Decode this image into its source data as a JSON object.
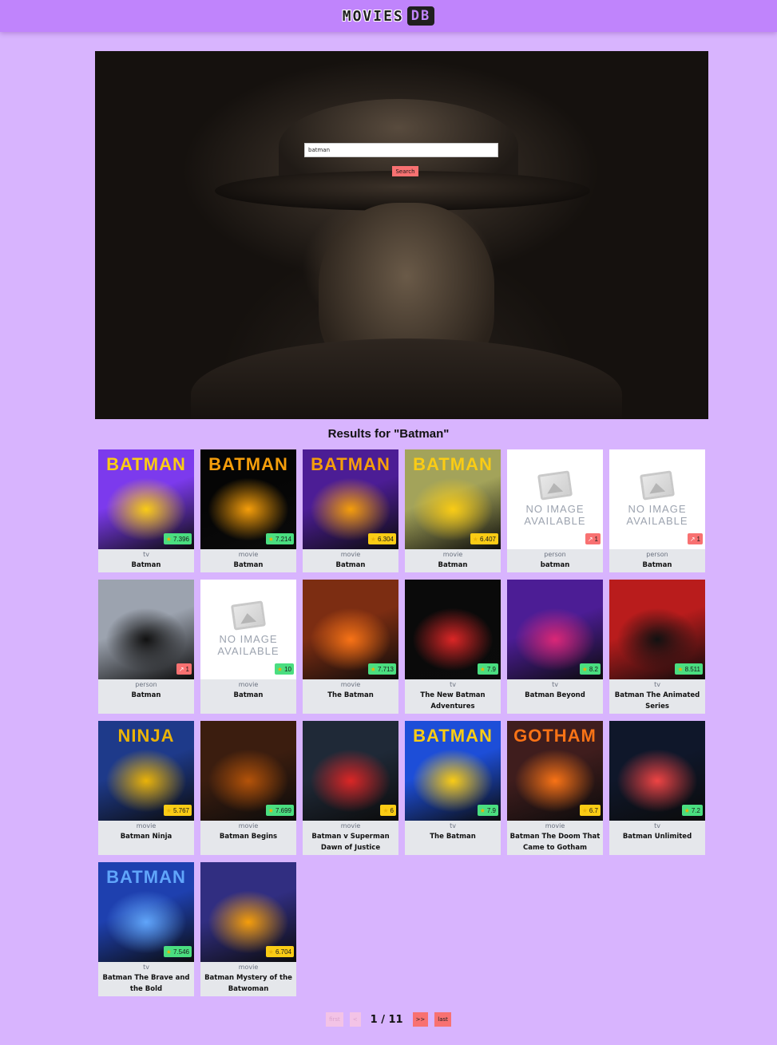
{
  "header": {
    "logo_text": "MOVIES",
    "logo_box": "DB"
  },
  "search": {
    "value": "batman",
    "placeholder": "",
    "button_label": "Search"
  },
  "results": {
    "heading": "Results for \"Batman\"",
    "items": [
      {
        "media_type": "tv",
        "title": "Batman",
        "rating": "7.396",
        "badge_kind": "rating",
        "image": "poster",
        "colors": [
          "#7c3aed",
          "#facc15"
        ],
        "poster_text": "BATMAN"
      },
      {
        "media_type": "movie",
        "title": "Batman",
        "rating": "7.214",
        "badge_kind": "rating",
        "image": "poster",
        "colors": [
          "#050505",
          "#f59e0b"
        ],
        "poster_text": "BATMAN"
      },
      {
        "media_type": "movie",
        "title": "Batman",
        "rating": "6.304",
        "badge_kind": "rating",
        "image": "poster",
        "colors": [
          "#4c1d95",
          "#f59e0b"
        ],
        "poster_text": "BATMAN"
      },
      {
        "media_type": "movie",
        "title": "Batman",
        "rating": "6.407",
        "badge_kind": "rating",
        "image": "poster",
        "colors": [
          "#a3a35a",
          "#facc15"
        ],
        "poster_text": "BATMAN"
      },
      {
        "media_type": "person",
        "title": "batman",
        "rating": "1",
        "badge_kind": "popularity",
        "image": "none",
        "noimg_text": "NO IMAGE AVAILABLE"
      },
      {
        "media_type": "person",
        "title": "Batman",
        "rating": "1",
        "badge_kind": "popularity",
        "image": "none",
        "noimg_text": "NO IMAGE AVAILABLE"
      },
      {
        "media_type": "person",
        "title": "Batman",
        "rating": "1",
        "badge_kind": "popularity",
        "image": "poster",
        "colors": [
          "#9ca3af",
          "#111111"
        ],
        "poster_text": ""
      },
      {
        "media_type": "movie",
        "title": "Batman",
        "rating": "10",
        "badge_kind": "rating",
        "image": "none",
        "noimg_text": "NO IMAGE AVAILABLE"
      },
      {
        "media_type": "movie",
        "title": "The Batman",
        "rating": "7.713",
        "badge_kind": "rating",
        "image": "poster",
        "colors": [
          "#7c2d12",
          "#f97316"
        ],
        "poster_text": ""
      },
      {
        "media_type": "tv",
        "title": "The New Batman Adventures",
        "rating": "7.9",
        "badge_kind": "rating",
        "image": "poster",
        "colors": [
          "#0a0a0a",
          "#dc2626"
        ],
        "poster_text": ""
      },
      {
        "media_type": "tv",
        "title": "Batman Beyond",
        "rating": "8.2",
        "badge_kind": "rating",
        "image": "poster",
        "colors": [
          "#4c1d95",
          "#db2777"
        ],
        "poster_text": ""
      },
      {
        "media_type": "tv",
        "title": "Batman The Animated Series",
        "rating": "8.511",
        "badge_kind": "rating",
        "image": "poster",
        "colors": [
          "#b91c1c",
          "#111111"
        ],
        "poster_text": ""
      },
      {
        "media_type": "movie",
        "title": "Batman Ninja",
        "rating": "5.767",
        "badge_kind": "rating",
        "image": "poster",
        "colors": [
          "#1e3a8a",
          "#eab308"
        ],
        "poster_text": "NINJA"
      },
      {
        "media_type": "movie",
        "title": "Batman Begins",
        "rating": "7.699",
        "badge_kind": "rating",
        "image": "poster",
        "colors": [
          "#3b1d0f",
          "#b45309"
        ],
        "poster_text": ""
      },
      {
        "media_type": "movie",
        "title": "Batman v Superman Dawn of Justice",
        "rating": "6",
        "badge_kind": "rating",
        "image": "poster",
        "colors": [
          "#1f2937",
          "#dc2626"
        ],
        "poster_text": ""
      },
      {
        "media_type": "tv",
        "title": "The Batman",
        "rating": "7.9",
        "badge_kind": "rating",
        "image": "poster",
        "colors": [
          "#1d4ed8",
          "#facc15"
        ],
        "poster_text": "BATMAN"
      },
      {
        "media_type": "movie",
        "title": "Batman The Doom That Came to Gotham",
        "rating": "6.7",
        "badge_kind": "rating",
        "image": "poster",
        "colors": [
          "#3f1d1d",
          "#f97316"
        ],
        "poster_text": "GOTHAM"
      },
      {
        "media_type": "tv",
        "title": "Batman Unlimited",
        "rating": "7.2",
        "badge_kind": "rating",
        "image": "poster",
        "colors": [
          "#0f172a",
          "#ef4444"
        ],
        "poster_text": ""
      },
      {
        "media_type": "tv",
        "title": "Batman The Brave and the Bold",
        "rating": "7.546",
        "badge_kind": "rating",
        "image": "poster",
        "colors": [
          "#1e40af",
          "#60a5fa"
        ],
        "poster_text": "BATMAN"
      },
      {
        "media_type": "movie",
        "title": "Batman Mystery of the Batwoman",
        "rating": "6.704",
        "badge_kind": "rating",
        "image": "poster",
        "colors": [
          "#312e81",
          "#f59e0b"
        ],
        "poster_text": ""
      }
    ]
  },
  "pagination": {
    "first_label": "first",
    "prev_label": "<",
    "current": "1 / 11",
    "next_label": ">>",
    "last_label": "last"
  },
  "colors": {
    "rating_badge": "#4ade80",
    "rating_badge_mid": "#facc15",
    "popularity_badge": "#f87171",
    "accent": "#c084fc",
    "background": "#d8b4fe"
  }
}
